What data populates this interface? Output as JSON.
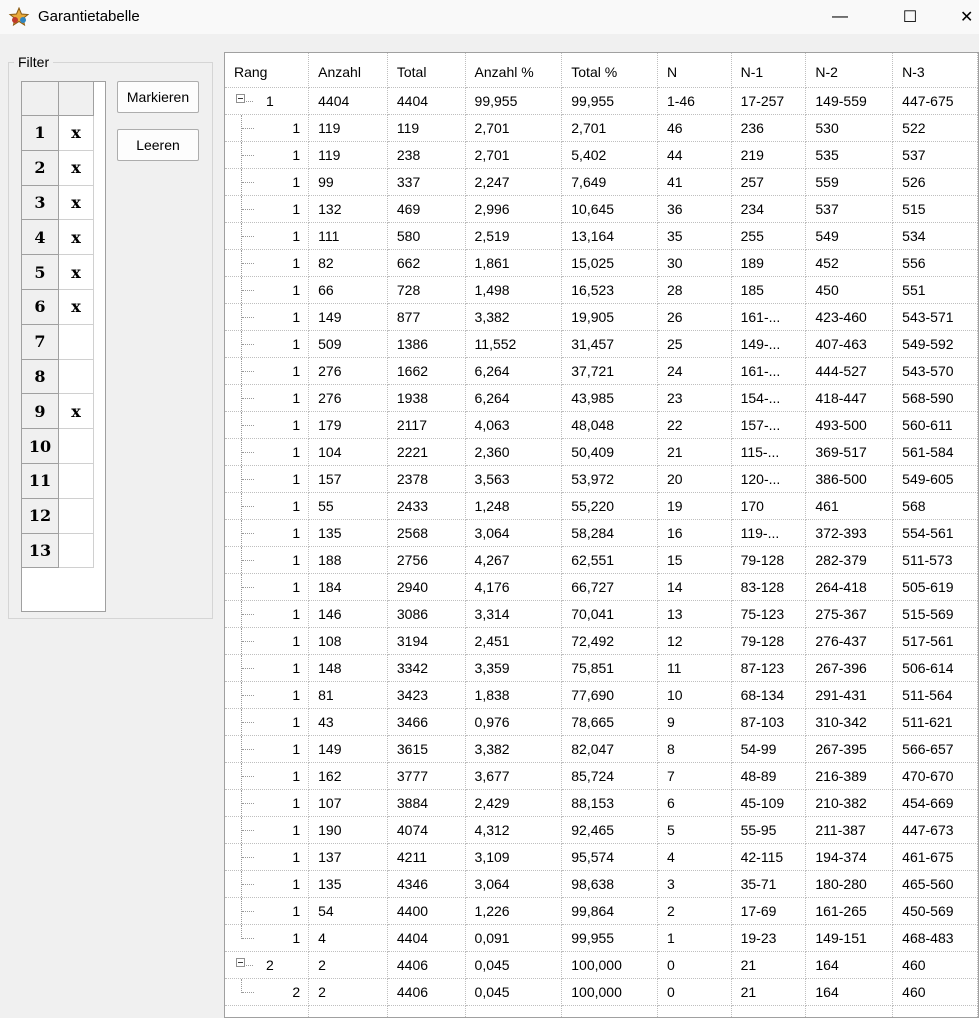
{
  "window": {
    "title": "Garantietabelle",
    "minimize": "—",
    "maximize": "☐",
    "close": "✕"
  },
  "filter": {
    "legend": "Filter",
    "rows": [
      {
        "num": "1",
        "mark": "x"
      },
      {
        "num": "2",
        "mark": "x"
      },
      {
        "num": "3",
        "mark": "x"
      },
      {
        "num": "4",
        "mark": "x"
      },
      {
        "num": "5",
        "mark": "x"
      },
      {
        "num": "6",
        "mark": "x"
      },
      {
        "num": "7",
        "mark": ""
      },
      {
        "num": "8",
        "mark": ""
      },
      {
        "num": "9",
        "mark": "x"
      },
      {
        "num": "10",
        "mark": ""
      },
      {
        "num": "11",
        "mark": ""
      },
      {
        "num": "12",
        "mark": ""
      },
      {
        "num": "13",
        "mark": ""
      }
    ],
    "mark_button": "Markieren",
    "clear_button": "Leeren"
  },
  "table": {
    "headers": [
      "Rang",
      "Anzahl",
      "Total",
      "Anzahl %",
      "Total %",
      "N",
      "N-1",
      "N-2",
      "N-3"
    ],
    "rows": [
      {
        "level": 0,
        "rang": "1",
        "cells": [
          "4404",
          "4404",
          "99,955",
          "99,955",
          "1-46",
          "17-257",
          "149-559",
          "447-675"
        ]
      },
      {
        "level": 1,
        "rang": "1",
        "cells": [
          "119",
          "119",
          "2,701",
          "2,701",
          "46",
          "236",
          "530",
          "522"
        ]
      },
      {
        "level": 1,
        "rang": "1",
        "cells": [
          "119",
          "238",
          "2,701",
          "5,402",
          "44",
          "219",
          "535",
          "537"
        ]
      },
      {
        "level": 1,
        "rang": "1",
        "cells": [
          "99",
          "337",
          "2,247",
          "7,649",
          "41",
          "257",
          "559",
          "526"
        ]
      },
      {
        "level": 1,
        "rang": "1",
        "cells": [
          "132",
          "469",
          "2,996",
          "10,645",
          "36",
          "234",
          "537",
          "515"
        ]
      },
      {
        "level": 1,
        "rang": "1",
        "cells": [
          "111",
          "580",
          "2,519",
          "13,164",
          "35",
          "255",
          "549",
          "534"
        ]
      },
      {
        "level": 1,
        "rang": "1",
        "cells": [
          "82",
          "662",
          "1,861",
          "15,025",
          "30",
          "189",
          "452",
          "556"
        ]
      },
      {
        "level": 1,
        "rang": "1",
        "cells": [
          "66",
          "728",
          "1,498",
          "16,523",
          "28",
          "185",
          "450",
          "551"
        ]
      },
      {
        "level": 1,
        "rang": "1",
        "cells": [
          "149",
          "877",
          "3,382",
          "19,905",
          "26",
          "161-...",
          "423-460",
          "543-571"
        ]
      },
      {
        "level": 1,
        "rang": "1",
        "cells": [
          "509",
          "1386",
          "11,552",
          "31,457",
          "25",
          "149-...",
          "407-463",
          "549-592"
        ]
      },
      {
        "level": 1,
        "rang": "1",
        "cells": [
          "276",
          "1662",
          "6,264",
          "37,721",
          "24",
          "161-...",
          "444-527",
          "543-570"
        ]
      },
      {
        "level": 1,
        "rang": "1",
        "cells": [
          "276",
          "1938",
          "6,264",
          "43,985",
          "23",
          "154-...",
          "418-447",
          "568-590"
        ]
      },
      {
        "level": 1,
        "rang": "1",
        "cells": [
          "179",
          "2117",
          "4,063",
          "48,048",
          "22",
          "157-...",
          "493-500",
          "560-611"
        ]
      },
      {
        "level": 1,
        "rang": "1",
        "cells": [
          "104",
          "2221",
          "2,360",
          "50,409",
          "21",
          "115-...",
          "369-517",
          "561-584"
        ]
      },
      {
        "level": 1,
        "rang": "1",
        "cells": [
          "157",
          "2378",
          "3,563",
          "53,972",
          "20",
          "120-...",
          "386-500",
          "549-605"
        ]
      },
      {
        "level": 1,
        "rang": "1",
        "cells": [
          "55",
          "2433",
          "1,248",
          "55,220",
          "19",
          "170",
          "461",
          "568"
        ]
      },
      {
        "level": 1,
        "rang": "1",
        "cells": [
          "135",
          "2568",
          "3,064",
          "58,284",
          "16",
          "119-...",
          "372-393",
          "554-561"
        ]
      },
      {
        "level": 1,
        "rang": "1",
        "cells": [
          "188",
          "2756",
          "4,267",
          "62,551",
          "15",
          "79-128",
          "282-379",
          "511-573"
        ]
      },
      {
        "level": 1,
        "rang": "1",
        "cells": [
          "184",
          "2940",
          "4,176",
          "66,727",
          "14",
          "83-128",
          "264-418",
          "505-619"
        ]
      },
      {
        "level": 1,
        "rang": "1",
        "cells": [
          "146",
          "3086",
          "3,314",
          "70,041",
          "13",
          "75-123",
          "275-367",
          "515-569"
        ]
      },
      {
        "level": 1,
        "rang": "1",
        "cells": [
          "108",
          "3194",
          "2,451",
          "72,492",
          "12",
          "79-128",
          "276-437",
          "517-561"
        ]
      },
      {
        "level": 1,
        "rang": "1",
        "cells": [
          "148",
          "3342",
          "3,359",
          "75,851",
          "11",
          "87-123",
          "267-396",
          "506-614"
        ]
      },
      {
        "level": 1,
        "rang": "1",
        "cells": [
          "81",
          "3423",
          "1,838",
          "77,690",
          "10",
          "68-134",
          "291-431",
          "511-564"
        ]
      },
      {
        "level": 1,
        "rang": "1",
        "cells": [
          "43",
          "3466",
          "0,976",
          "78,665",
          "9",
          "87-103",
          "310-342",
          "511-621"
        ]
      },
      {
        "level": 1,
        "rang": "1",
        "cells": [
          "149",
          "3615",
          "3,382",
          "82,047",
          "8",
          "54-99",
          "267-395",
          "566-657"
        ]
      },
      {
        "level": 1,
        "rang": "1",
        "cells": [
          "162",
          "3777",
          "3,677",
          "85,724",
          "7",
          "48-89",
          "216-389",
          "470-670"
        ]
      },
      {
        "level": 1,
        "rang": "1",
        "cells": [
          "107",
          "3884",
          "2,429",
          "88,153",
          "6",
          "45-109",
          "210-382",
          "454-669"
        ]
      },
      {
        "level": 1,
        "rang": "1",
        "cells": [
          "190",
          "4074",
          "4,312",
          "92,465",
          "5",
          "55-95",
          "211-387",
          "447-673"
        ]
      },
      {
        "level": 1,
        "rang": "1",
        "cells": [
          "137",
          "4211",
          "3,109",
          "95,574",
          "4",
          "42-115",
          "194-374",
          "461-675"
        ]
      },
      {
        "level": 1,
        "rang": "1",
        "cells": [
          "135",
          "4346",
          "3,064",
          "98,638",
          "3",
          "35-71",
          "180-280",
          "465-560"
        ]
      },
      {
        "level": 1,
        "rang": "1",
        "cells": [
          "54",
          "4400",
          "1,226",
          "99,864",
          "2",
          "17-69",
          "161-265",
          "450-569"
        ]
      },
      {
        "level": 1,
        "rang": "1",
        "last": true,
        "cells": [
          "4",
          "4404",
          "0,091",
          "99,955",
          "1",
          "19-23",
          "149-151",
          "468-483"
        ]
      },
      {
        "level": 0,
        "rang": "2",
        "cells": [
          "2",
          "4406",
          "0,045",
          "100,000",
          "0",
          "21",
          "164",
          "460"
        ]
      },
      {
        "level": 1,
        "rang": "2",
        "last": true,
        "cells": [
          "2",
          "4406",
          "0,045",
          "100,000",
          "0",
          "21",
          "164",
          "460"
        ]
      }
    ]
  }
}
